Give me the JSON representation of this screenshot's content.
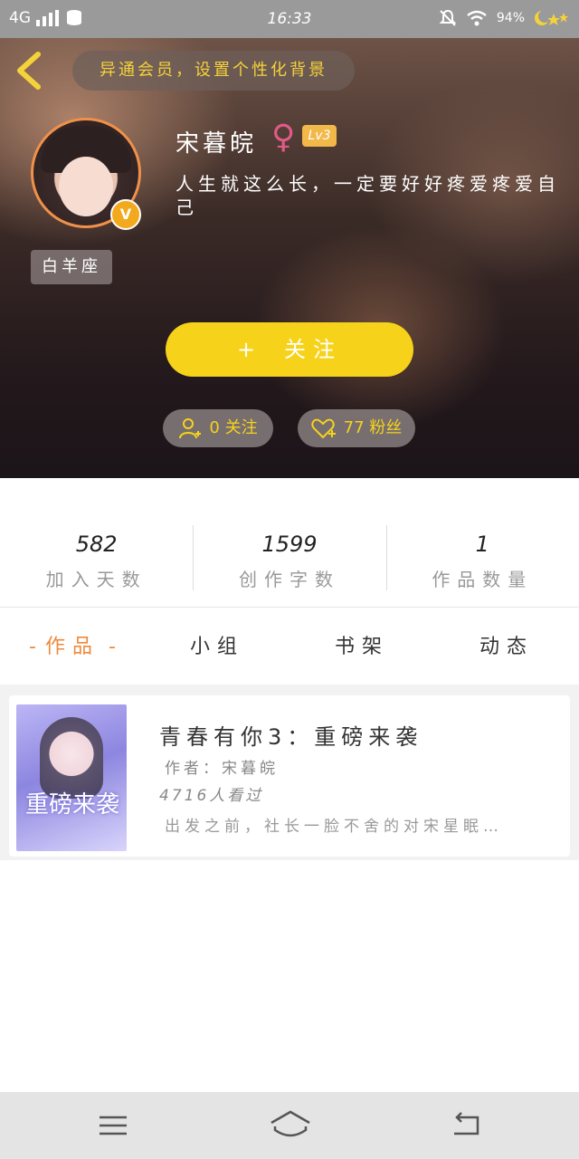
{
  "status_bar": {
    "network": "4G",
    "time": "16:33",
    "battery": "94%",
    "icons": [
      "signal-icon",
      "data-icon",
      "mute-icon",
      "wifi-icon",
      "battery-icon"
    ]
  },
  "header": {
    "background_button": "异通会员，设置个性化背景"
  },
  "profile": {
    "username": "宋暮皖",
    "gender_symbol": "♀",
    "level": "Lv3",
    "vip_badge": "V",
    "bio": "人生就这么长，一定要好好疼爱疼爱自己",
    "zodiac": "白羊座"
  },
  "actions": {
    "follow_plus": "+",
    "follow_label": "关注",
    "following_text": "0 关注",
    "fans_text": "77 粉丝"
  },
  "stats": [
    {
      "value": "582",
      "label": "加入天数"
    },
    {
      "value": "1599",
      "label": "创作字数"
    },
    {
      "value": "1",
      "label": "作品数量"
    }
  ],
  "tabs": {
    "works_dash": "-",
    "works": "作品",
    "groups": "小组",
    "bookshelf": "书架",
    "updates": "动态"
  },
  "work": {
    "title": "青春有你3：重磅来袭",
    "author": "作者：宋暮皖",
    "views": "4716人看过",
    "description": "出发之前，社长一脸不舍的对宋星眠…",
    "cover_title": "重磅来袭"
  },
  "colors": {
    "accent_yellow": "#f6d31a",
    "accent_orange": "#ee8a3c",
    "gender_pink": "#e05a88"
  }
}
